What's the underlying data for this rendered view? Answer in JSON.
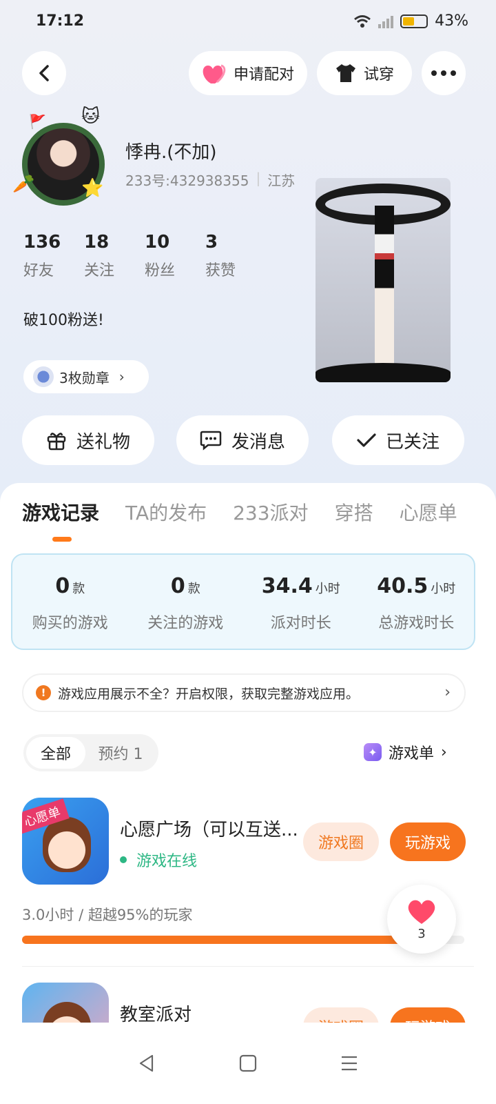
{
  "status_bar": {
    "time": "17:12",
    "battery": "43%"
  },
  "top_actions": {
    "pair_label": "申请配对",
    "try_label": "试穿"
  },
  "profile": {
    "name": "悸冉.(不加)",
    "id_text": "233号:432938355",
    "location": "江苏",
    "stats": [
      {
        "value": "136",
        "label": "好友"
      },
      {
        "value": "18",
        "label": "关注"
      },
      {
        "value": "10",
        "label": "粉丝"
      },
      {
        "value": "3",
        "label": "获赞"
      }
    ],
    "bio": "破100粉送!",
    "medals": "3枚勋章"
  },
  "actions": {
    "gift": "送礼物",
    "message": "发消息",
    "followed": "已关注"
  },
  "tabs": [
    "游戏记录",
    "TA的发布",
    "233派对",
    "穿搭",
    "心愿单"
  ],
  "summary": [
    {
      "value": "0",
      "unit": "款",
      "label": "购买的游戏"
    },
    {
      "value": "0",
      "unit": "款",
      "label": "关注的游戏"
    },
    {
      "value": "34.4",
      "unit": "小时",
      "label": "派对时长"
    },
    {
      "value": "40.5",
      "unit": "小时",
      "label": "总游戏时长"
    }
  ],
  "notice": "游戏应用展示不全？开启权限，获取完整游戏应用。",
  "filter": {
    "all": "全部",
    "reserve": "预约 1",
    "game_list": "游戏单"
  },
  "games": [
    {
      "title": "心愿广场（可以互送...",
      "icon_tag": "心愿单",
      "status": "游戏在线",
      "circle_label": "游戏圈",
      "play_label": "玩游戏",
      "playtime": "3.0小时 / 超越95%的玩家",
      "progress": 0.95
    },
    {
      "title": "教室派对",
      "circle_label": "游戏圈",
      "play_label": "玩游戏"
    }
  ],
  "like_count": "3",
  "colors": {
    "accent": "#f7741e",
    "online": "#2db784",
    "summary_bg": "#eef8fd"
  }
}
